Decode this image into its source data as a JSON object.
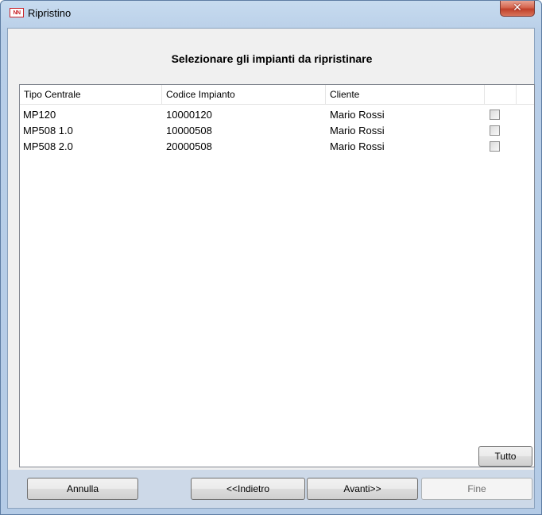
{
  "window": {
    "title": "Ripristino",
    "app_icon_text": "NN",
    "close_symbol": "✕"
  },
  "heading": "Selezionare gli impianti da ripristinare",
  "table": {
    "columns": [
      "Tipo Centrale",
      "Codice Impianto",
      "Cliente",
      ""
    ],
    "rows": [
      {
        "tipo": "MP120",
        "codice": "10000120",
        "cliente": "Mario Rossi",
        "checked": false
      },
      {
        "tipo": "MP508 1.0",
        "codice": "10000508",
        "cliente": "Mario Rossi",
        "checked": false
      },
      {
        "tipo": "MP508 2.0",
        "codice": "20000508",
        "cliente": "Mario Rossi",
        "checked": false
      }
    ]
  },
  "buttons": {
    "tutto": "Tutto",
    "annulla": "Annulla",
    "indietro": "<<Indietro",
    "avanti": "Avanti>>",
    "fine": "Fine"
  }
}
